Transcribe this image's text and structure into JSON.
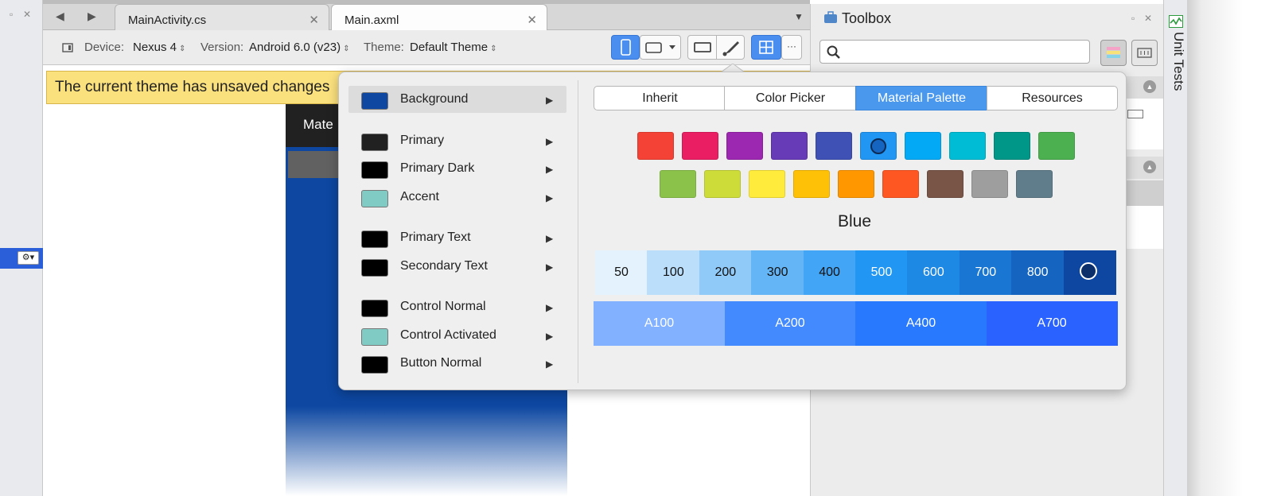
{
  "tabs": [
    {
      "label": "MainActivity.cs",
      "close": "✕"
    },
    {
      "label": "Main.axml",
      "close": "✕"
    }
  ],
  "toolbar": {
    "device_label": "Device:",
    "device_value": "Nexus 4",
    "version_label": "Version:",
    "version_value": "Android 6.0 (v23)",
    "theme_label": "Theme:",
    "theme_value": "Default Theme",
    "more": "···"
  },
  "banner": "The current theme has unsaved changes",
  "phone": {
    "title": "Mate"
  },
  "toolbox": {
    "title": "Toolbox",
    "search_placeholder": ""
  },
  "sidebar": {
    "unit_tests": "Unit Tests"
  },
  "theme_menu": [
    {
      "label": "Background",
      "color": "#0d47a1",
      "selected": true
    },
    {
      "label": "Primary",
      "color": "#212121"
    },
    {
      "label": "Primary Dark",
      "color": "#000000"
    },
    {
      "label": "Accent",
      "color": "#80cbc4"
    },
    {
      "label": "Primary Text",
      "color": "#000000"
    },
    {
      "label": "Secondary Text",
      "color": "#000000"
    },
    {
      "label": "Control Normal",
      "color": "#000000"
    },
    {
      "label": "Control Activated",
      "color": "#80cbc4"
    },
    {
      "label": "Button Normal",
      "color": "#000000"
    }
  ],
  "picker_tabs": [
    {
      "label": "Inherit"
    },
    {
      "label": "Color Picker"
    },
    {
      "label": "Material Palette",
      "selected": true
    },
    {
      "label": "Resources"
    }
  ],
  "palette_row1": [
    "#f44336",
    "#e91e63",
    "#9c27b0",
    "#673ab7",
    "#3f51b5",
    "#2196f3",
    "#03a9f4",
    "#00bcd4",
    "#009688",
    "#4caf50"
  ],
  "palette_row2": [
    "#8bc34a",
    "#cddc39",
    "#ffeb3b",
    "#ffc107",
    "#ff9800",
    "#ff5722",
    "#795548",
    "#9e9e9e",
    "#607d8b"
  ],
  "selected_color_name": "Blue",
  "shades": [
    {
      "label": "50",
      "color": "#e3f2fd"
    },
    {
      "label": "100",
      "color": "#bbdefb"
    },
    {
      "label": "200",
      "color": "#90caf9"
    },
    {
      "label": "300",
      "color": "#64b5f6"
    },
    {
      "label": "400",
      "color": "#42a5f5"
    },
    {
      "label": "500",
      "color": "#2196f3"
    },
    {
      "label": "600",
      "color": "#1e88e5"
    },
    {
      "label": "700",
      "color": "#1976d2"
    },
    {
      "label": "800",
      "color": "#1565c0"
    },
    {
      "label": "",
      "color": "#0d47a1",
      "selected": true
    }
  ],
  "accents": [
    {
      "label": "A100",
      "color": "#82b1ff"
    },
    {
      "label": "A200",
      "color": "#448aff"
    },
    {
      "label": "A400",
      "color": "#2979ff"
    },
    {
      "label": "A700",
      "color": "#2962ff"
    }
  ]
}
